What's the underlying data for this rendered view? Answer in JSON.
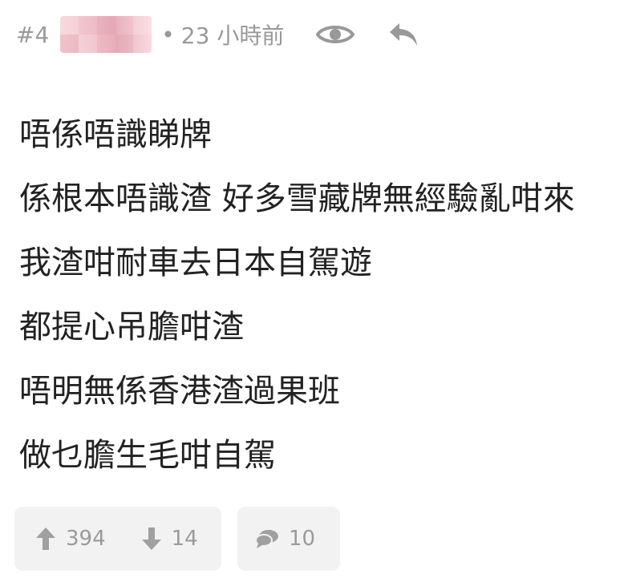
{
  "post": {
    "number": "#4",
    "separator": "•",
    "time": "23 小時前",
    "lines": [
      "唔係唔識睇牌",
      "係根本唔識渣 好多雪藏牌無經驗亂咁來",
      "我渣咁耐車去日本自駕遊",
      "都提心吊膽咁渣",
      "唔明無係香港渣過果班",
      "做乜膽生毛咁自駕"
    ],
    "upvotes": "394",
    "downvotes": "14",
    "comments": "10"
  },
  "icons": {
    "view": "eye-icon",
    "reply": "reply-icon",
    "upvote": "arrow-up-icon",
    "downvote": "arrow-down-icon",
    "comment": "comment-icon"
  },
  "colors": {
    "meta_gray": "#999999",
    "text": "#222222",
    "box_bg": "#f2f2f2"
  }
}
